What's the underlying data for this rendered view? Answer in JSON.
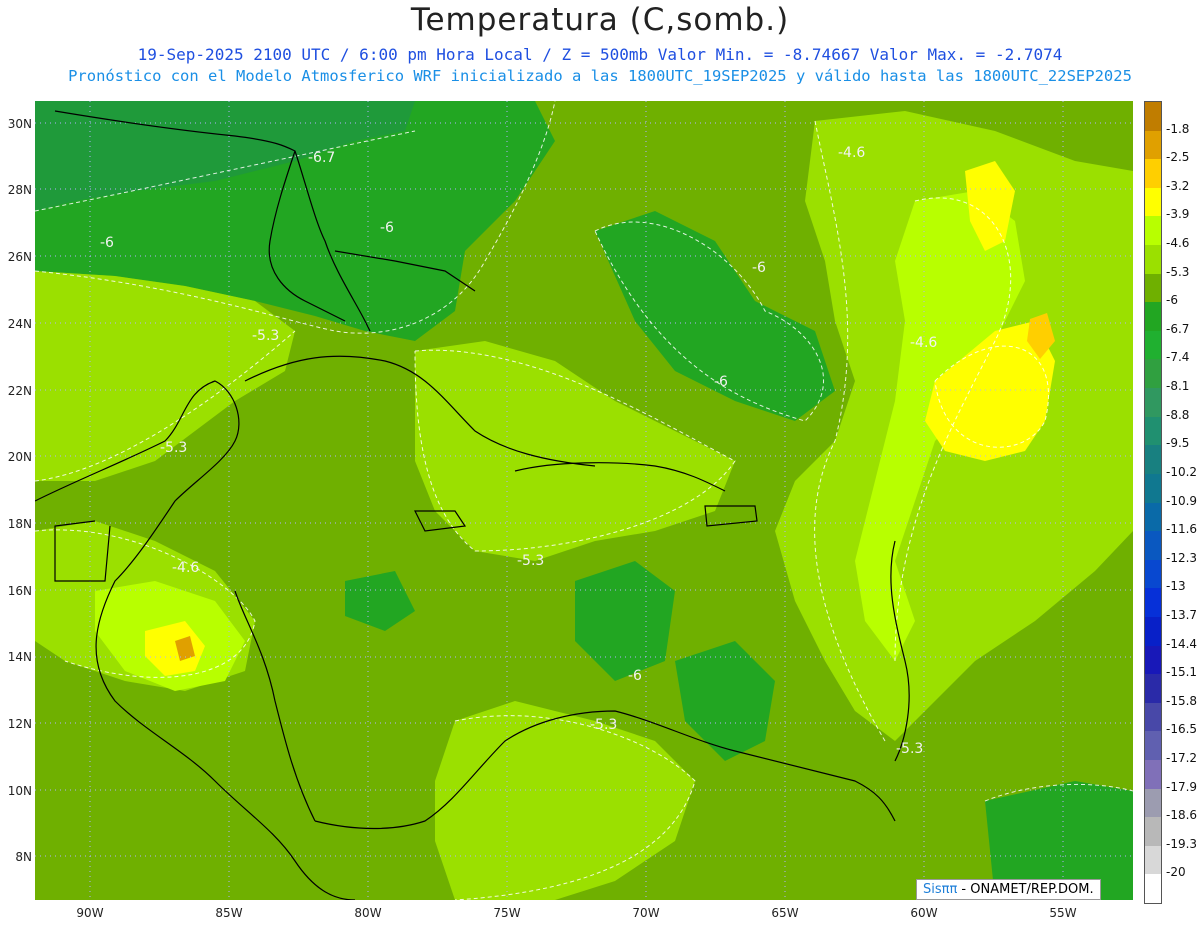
{
  "title": "Temperatura (C,somb.)",
  "subtitle1": "19-Sep-2025  2100 UTC / 6:00 pm Hora Local / Z = 500mb   Valor Min. = -8.74667  Valor Max. = -2.7074",
  "subtitle2": "Pronóstico con el Modelo Atmosferico WRF inicializado a las 1800UTC_19SEP2025 y válido hasta las  1800UTC_22SEP2025",
  "lat_labels": [
    "30N",
    "28N",
    "26N",
    "24N",
    "22N",
    "20N",
    "18N",
    "16N",
    "14N",
    "12N",
    "10N",
    "8N"
  ],
  "lon_labels": [
    "90W",
    "85W",
    "80W",
    "75W",
    "70W",
    "65W",
    "60W",
    "55W"
  ],
  "colorbar": {
    "labels": [
      "-1.8",
      "-2.5",
      "-3.2",
      "-3.9",
      "-4.6",
      "-5.3",
      "-6",
      "-6.7",
      "-7.4",
      "-8.1",
      "-8.8",
      "-9.5",
      "-10.2",
      "-10.9",
      "-11.6",
      "-12.3",
      "-13",
      "-13.7",
      "-14.4",
      "-15.1",
      "-15.8",
      "-16.5",
      "-17.2",
      "-17.9",
      "-18.6",
      "-19.3",
      "-20"
    ],
    "colors": [
      "#c07d00",
      "#e0a000",
      "#ffcf00",
      "#ffff00",
      "#b8ff00",
      "#9be000",
      "#6fb000",
      "#22a622",
      "#20b030",
      "#30a040",
      "#309860",
      "#209070",
      "#188080",
      "#107890",
      "#0a6aa8",
      "#0a58c0",
      "#0848d0",
      "#0630d8",
      "#0820c8",
      "#1818b8",
      "#2a2aa8",
      "#4848a8",
      "#6060b0",
      "#8070b8",
      "#9c9cb0",
      "#b8b8b8",
      "#d8d8d8",
      "#ffffff"
    ]
  },
  "contour_labels": [
    {
      "text": "-6.7"
    },
    {
      "text": "-6"
    },
    {
      "text": "-6"
    },
    {
      "text": "-4.6"
    },
    {
      "text": "-6"
    },
    {
      "text": "-5.3"
    },
    {
      "text": "-4.6"
    },
    {
      "text": "-6"
    },
    {
      "text": "-5.3"
    },
    {
      "text": "-4.6"
    },
    {
      "text": "-5.3"
    },
    {
      "text": "-6"
    },
    {
      "text": "-5.3"
    },
    {
      "text": "-5.3"
    }
  ],
  "credit": {
    "brand": "Sisππ",
    "text": " - ONAMET/REP.DOM."
  },
  "field": {
    "variable": "Temperatura",
    "level": "500mb",
    "min": -8.74667,
    "max": -2.7074
  }
}
